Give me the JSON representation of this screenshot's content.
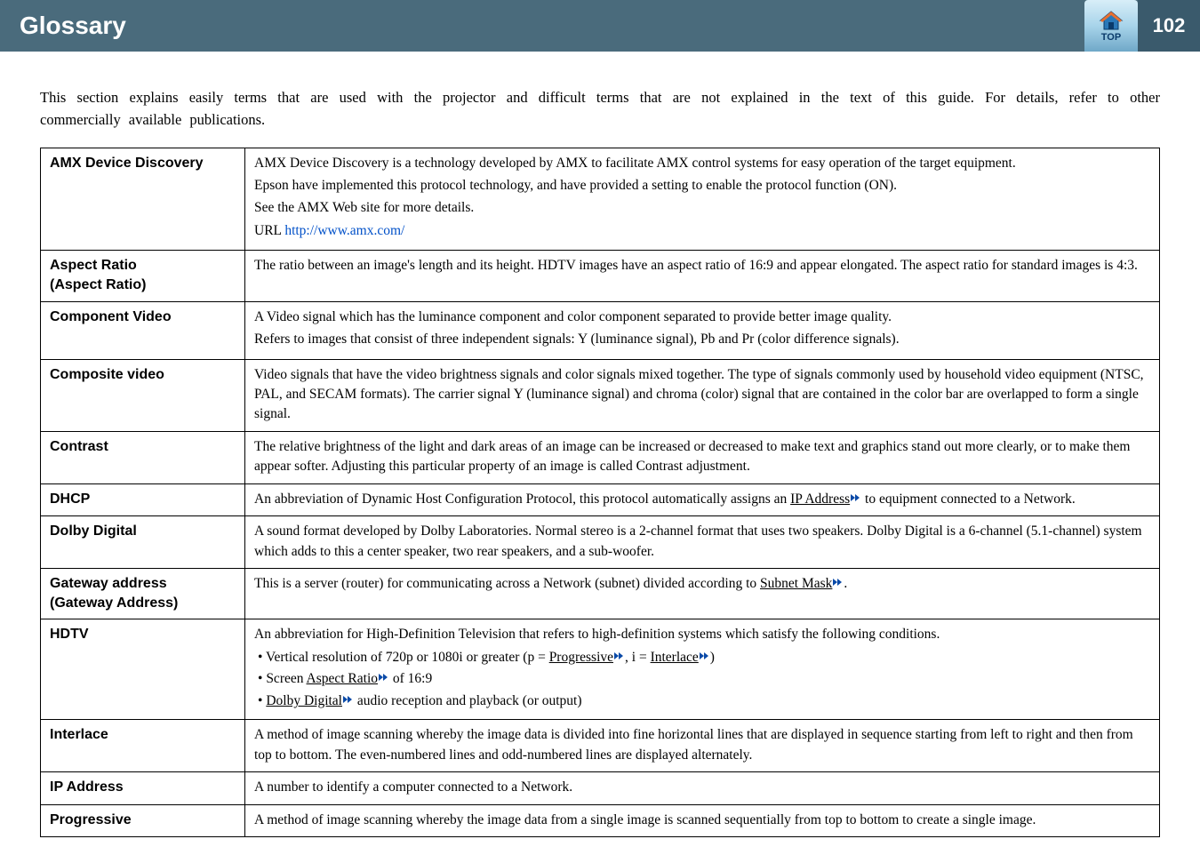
{
  "header": {
    "title": "Glossary",
    "top_label": "TOP",
    "page_number": "102"
  },
  "intro": "This section explains easily terms that are used with the projector and difficult terms that are not explained in the text of this guide. For details, refer to other commercially available publications.",
  "rows": {
    "amx": {
      "term": "AMX Device Discovery",
      "p1": "AMX Device Discovery is a technology developed by AMX to facilitate AMX control systems for easy operation of the target equipment.",
      "p2": "Epson have implemented this protocol technology, and have provided a setting to enable the protocol function (ON).",
      "p3": "See the AMX Web site for more details.",
      "url_prefix": "URL ",
      "url": "http://www.amx.com/"
    },
    "aspect": {
      "term1": "Aspect Ratio",
      "term2": "(Aspect Ratio)",
      "def": "The ratio between an image's length and its height. HDTV images have an aspect ratio of 16:9 and appear elongated. The aspect ratio for standard images is 4:3."
    },
    "component": {
      "term": "Component Video",
      "p1": "A Video signal which has the luminance component and color component separated to provide better image quality.",
      "p2": "Refers to images that consist of three independent signals: Y (luminance signal), Pb and Pr (color difference signals)."
    },
    "composite": {
      "term": "Composite video",
      "def": "Video signals that have the video brightness signals and color signals mixed together. The type of signals commonly used by household video equipment (NTSC, PAL, and SECAM formats). The carrier signal Y (luminance signal) and chroma (color) signal that are contained in the color bar are overlapped to form a single signal."
    },
    "contrast": {
      "term": "Contrast",
      "def": "The relative brightness of the light and dark areas of an image can be increased or decreased to make text and graphics stand out more clearly, or to make them appear softer. Adjusting this particular property of an image is called Contrast adjustment."
    },
    "dhcp": {
      "term": "DHCP",
      "pre": "An abbreviation of Dynamic Host Configuration Protocol, this protocol automatically assigns an ",
      "xref": "IP Address",
      "post": " to equipment connected to a Network."
    },
    "dolby": {
      "term": "Dolby Digital",
      "def": "A sound format developed by Dolby Laboratories. Normal stereo is a 2-channel format that uses two speakers. Dolby Digital is a 6-channel (5.1-channel) system which adds to this a center speaker, two rear speakers, and a sub-woofer."
    },
    "gateway": {
      "term1": "Gateway address",
      "term2": "(Gateway Address)",
      "pre": "This is a server (router) for communicating across a Network (subnet) divided according to ",
      "xref": "Subnet Mask",
      "post": "."
    },
    "hdtv": {
      "term": "HDTV",
      "p1": "An abbreviation for High-Definition Television that refers to high-definition systems which satisfy the following conditions.",
      "b1_pre": "Vertical resolution of 720p or 1080i or greater (p = ",
      "b1_x1": "Progressive",
      "b1_mid": ", i = ",
      "b1_x2": "Interlace",
      "b1_post": ")",
      "b2_pre": "Screen ",
      "b2_x": "Aspect Ratio",
      "b2_post": " of 16:9",
      "b3_x": "Dolby Digital",
      "b3_post": " audio reception and playback (or output)"
    },
    "interlace": {
      "term": "Interlace",
      "def": "A method of image scanning whereby the image data is divided into fine horizontal lines that are displayed in sequence starting from left to right and then from top to bottom. The even-numbered lines and odd-numbered lines are displayed alternately."
    },
    "ipaddr": {
      "term": "IP Address",
      "def": "A number to identify a computer connected to a Network."
    },
    "progressive": {
      "term": "Progressive",
      "def": "A method of image scanning whereby the image data from a single image is scanned sequentially from top to bottom to create a single image."
    }
  }
}
